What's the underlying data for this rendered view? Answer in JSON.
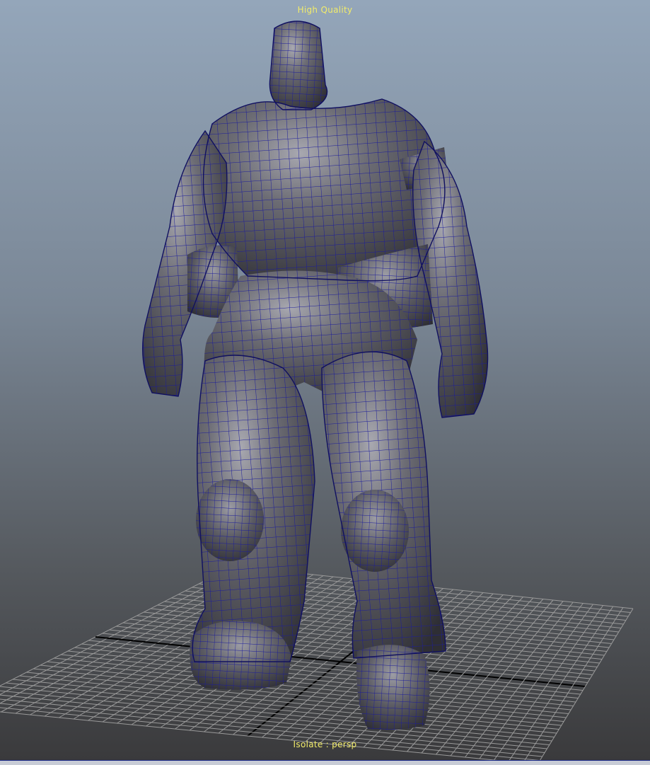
{
  "viewport": {
    "name": "persp",
    "quality_label": "High Quality",
    "isolate_label": "Isolate : persp",
    "wireframe_on_shaded": true
  },
  "colors": {
    "hud_text": "#f2ec6a",
    "wireframe": "#1c1c9a",
    "grid": "#9a9a9a",
    "grid_axis": "#000000",
    "bg_top": "#94a6ba",
    "bg_bottom": "#3a3a3c",
    "mesh_base": "#5c5c62"
  },
  "model": {
    "kind": "character-mesh"
  }
}
